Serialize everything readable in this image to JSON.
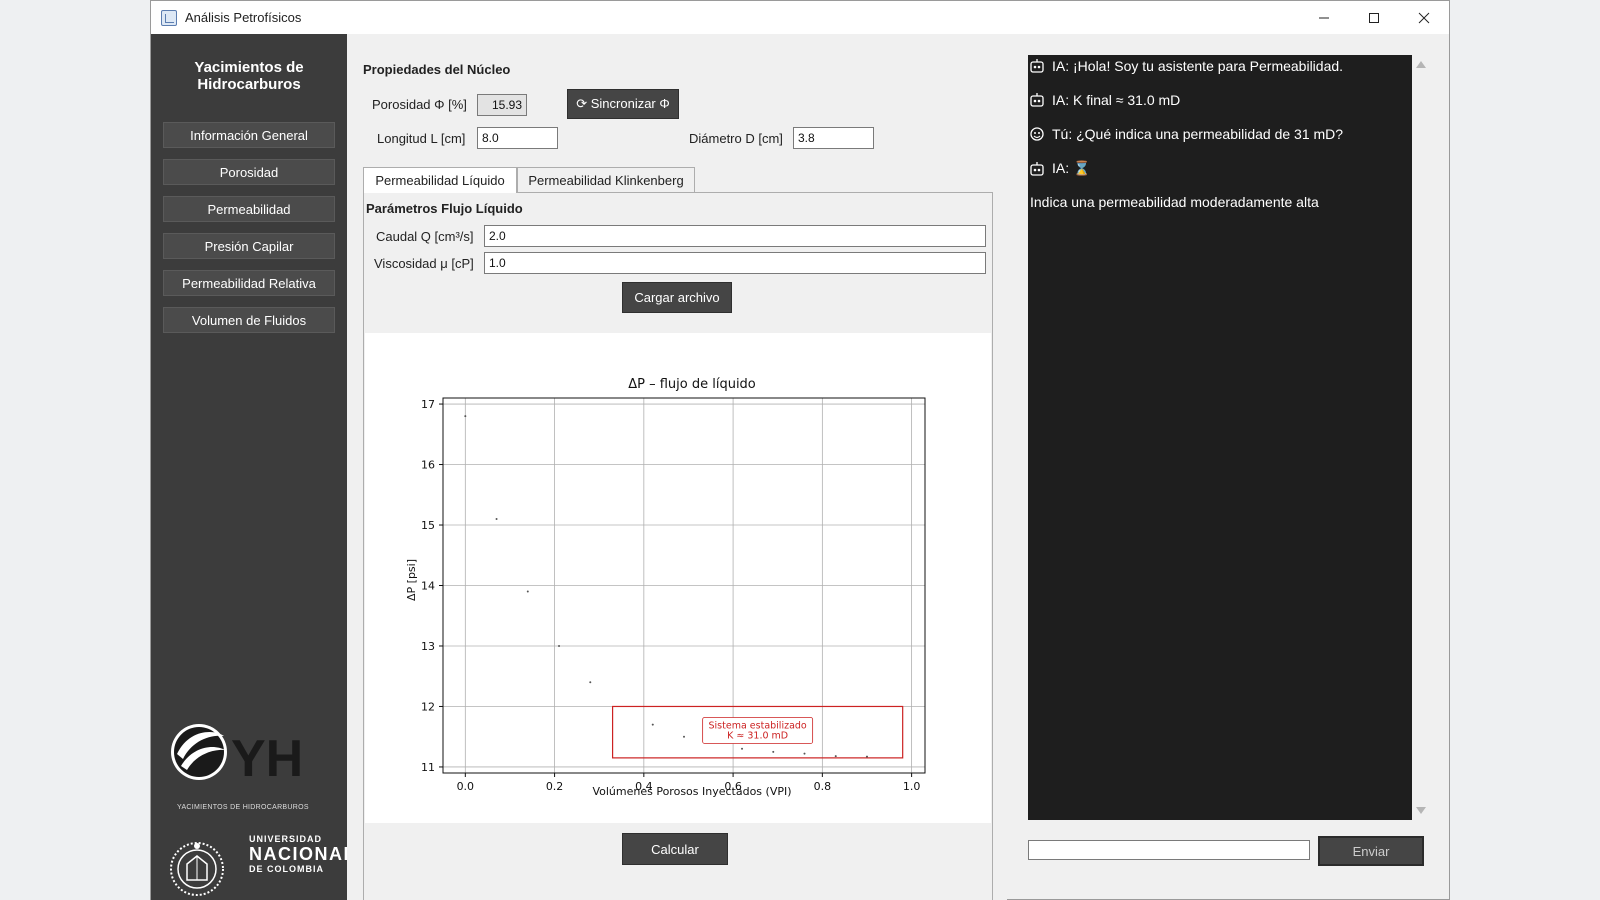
{
  "window": {
    "title": "Análisis Petrofísicos"
  },
  "sidebar": {
    "brand": [
      "Yacimientos de",
      "Hidrocarburos"
    ],
    "items": [
      {
        "label": "Información General"
      },
      {
        "label": "Porosidad"
      },
      {
        "label": "Permeabilidad"
      },
      {
        "label": "Presión Capilar"
      },
      {
        "label": "Permeabilidad Relativa"
      },
      {
        "label": "Volumen de Fluidos"
      }
    ],
    "logo_yh": {
      "text": "YH",
      "subtitle": "YACIMIENTOS DE HIDROCARBUROS"
    },
    "logo_un": {
      "line1": "UNIVERSIDAD",
      "line2": "NACIONAL",
      "line3": "DE COLOMBIA"
    }
  },
  "core": {
    "title": "Propiedades del Núcleo",
    "porosity_label": "Porosidad Φ [%]",
    "porosity_value": "15.93",
    "sync_label": "⟳ Sincronizar Φ",
    "length_label": "Longitud L [cm]",
    "length_value": "8.0",
    "diameter_label": "Diámetro D [cm]",
    "diameter_value": "3.8"
  },
  "tabs": [
    {
      "label": "Permeabilidad Líquido",
      "active": true
    },
    {
      "label": "Permeabilidad Klinkenberg",
      "active": false
    }
  ],
  "liquid": {
    "params_title": "Parámetros Flujo Líquido",
    "flow_label": "Caudal Q [cm³/s]",
    "flow_value": "2.0",
    "viscosity_label": "Viscosidad μ [cP]",
    "viscosity_value": "1.0",
    "load_label": "Cargar archivo",
    "calc_label": "Calcular"
  },
  "chart_data": {
    "type": "scatter",
    "title": "ΔP – flujo de líquido",
    "xlabel": "Volúmenes Porosos Inyectados (VPI)",
    "ylabel": "ΔP [psi]",
    "xlim": [
      -0.05,
      1.03
    ],
    "ylim": [
      10.9,
      17.1
    ],
    "xticks": [
      0.0,
      0.2,
      0.4,
      0.6,
      0.8,
      1.0
    ],
    "xtick_labels": [
      "0.0",
      "0.2",
      "0.4",
      "0.6",
      "0.8",
      "1.0"
    ],
    "yticks": [
      11,
      12,
      13,
      14,
      15,
      16,
      17
    ],
    "ytick_labels": [
      "11",
      "12",
      "13",
      "14",
      "15",
      "16",
      "17"
    ],
    "grid": true,
    "points": {
      "x": [
        0.0,
        0.07,
        0.14,
        0.21,
        0.28,
        0.42,
        0.49,
        0.62,
        0.69,
        0.76,
        0.83,
        0.9
      ],
      "y": [
        16.8,
        15.1,
        13.9,
        13.0,
        12.4,
        11.7,
        11.5,
        11.3,
        11.25,
        11.22,
        11.18,
        11.17
      ]
    },
    "highlight_box": {
      "x": [
        0.33,
        0.98
      ],
      "y": [
        11.15,
        12.0
      ]
    },
    "annotation": [
      "Sistema estabilizado",
      "K ≈ 31.0 mD"
    ],
    "point_color": "#555555",
    "highlight_color": "#cc2222"
  },
  "chat": {
    "messages": [
      {
        "icon": "robot-icon",
        "text": "IA: ¡Hola! Soy tu asistente para Permeabilidad."
      },
      {
        "icon": "robot-icon",
        "text": "IA: K final ≈ 31.0 mD"
      },
      {
        "icon": "user-icon",
        "text": "Tú: ¿Qué indica una permeabilidad de 31 mD?"
      },
      {
        "icon": "robot-icon",
        "text": "IA: ⌛"
      },
      {
        "icon": "",
        "text": "Indica una permeabilidad moderadamente alta"
      }
    ],
    "input_value": "",
    "send_label": "Enviar"
  }
}
